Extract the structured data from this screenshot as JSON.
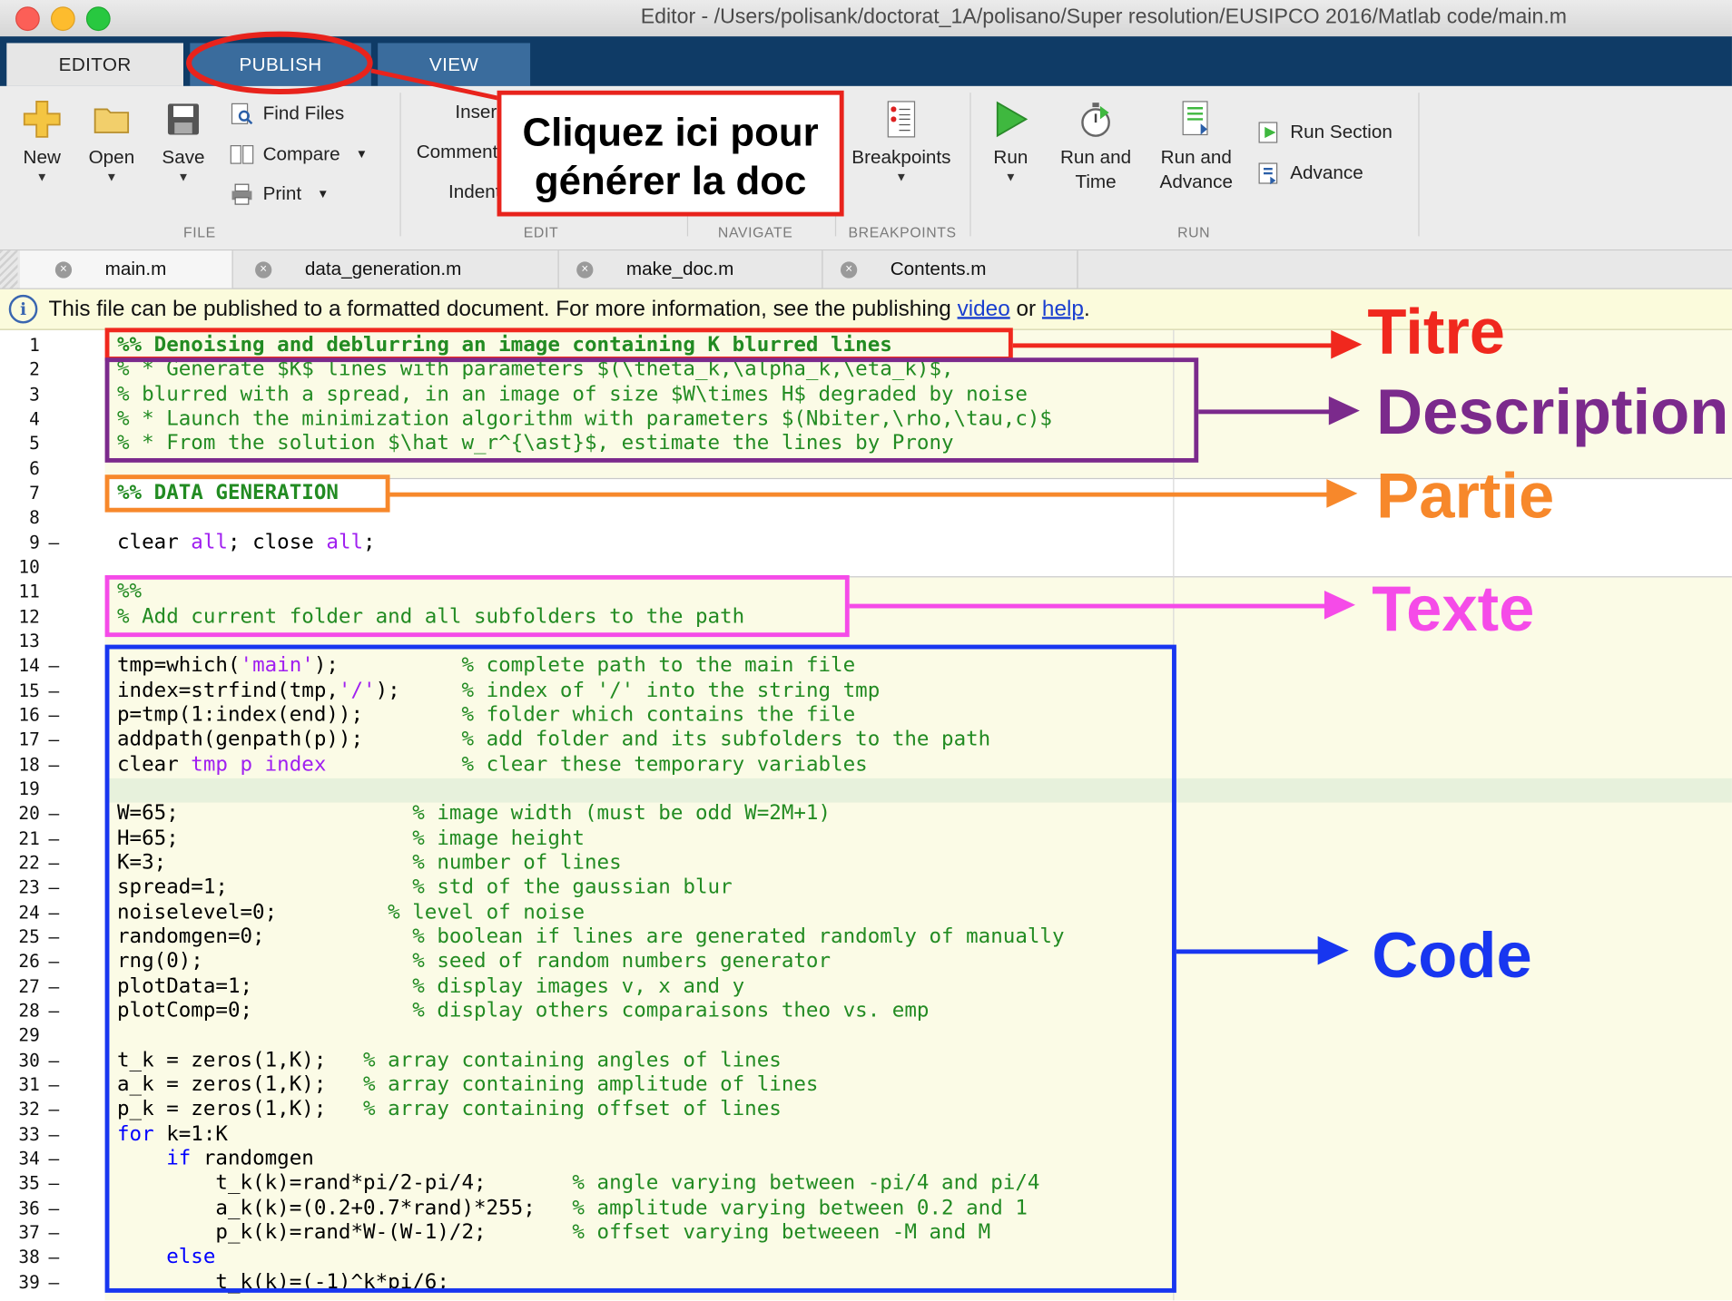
{
  "window": {
    "title": "Editor - /Users/polisank/doctorat_1A/polisano/Super resolution/EUSIPCO 2016/Matlab code/main.m"
  },
  "ribbon_tabs": [
    "EDITOR",
    "PUBLISH",
    "VIEW"
  ],
  "ribbon": {
    "file": {
      "new": "New",
      "open": "Open",
      "save": "Save",
      "find_files": "Find Files",
      "compare": "Compare",
      "print": "Print",
      "label": "FILE"
    },
    "edit": {
      "insert": "Insert",
      "comment": "Comment",
      "indent": "Indent",
      "label": "EDIT"
    },
    "navigate": {
      "label": "NAVIGATE"
    },
    "breakpoints": {
      "breakpoints": "Breakpoints",
      "label": "BREAKPOINTS"
    },
    "run": {
      "run": "Run",
      "run_and_time": [
        "Run and",
        "Time"
      ],
      "run_and_advance": [
        "Run and",
        "Advance"
      ],
      "run_section": "Run Section",
      "advance": "Advance",
      "label": "RUN"
    }
  },
  "file_tabs": [
    "main.m",
    "data_generation.m",
    "make_doc.m",
    "Contents.m"
  ],
  "infobar": {
    "text": "This file can be published to a formatted document. For more information, see the publishing",
    "link_video": "video",
    "or": "or",
    "link_help": "help",
    "end": "."
  },
  "code_lines": [
    [
      [
        "%% Denoising and deblurring an image containing K blurred lines",
        "com bold"
      ]
    ],
    [
      [
        "% * Generate $K$ lines with parameters $(\\theta_k,\\alpha_k,\\eta_k)$,",
        "com"
      ]
    ],
    [
      [
        "% blurred with a spread, in an image of size $W\\times H$ degraded by noise",
        "com"
      ]
    ],
    [
      [
        "% * Launch the minimization algorithm with parameters $(Nbiter,\\rho,\\tau,c)$",
        "com"
      ]
    ],
    [
      [
        "% * From the solution $\\hat w_r^{\\ast}$, estimate the lines by Prony",
        "com"
      ]
    ],
    [],
    [
      [
        "%% DATA GENERATION",
        "com bold"
      ]
    ],
    [],
    [
      [
        "clear ",
        ""
      ],
      [
        "all",
        ""
      ],
      [
        "; close ",
        ""
      ],
      [
        "all",
        ""
      ],
      [
        ";",
        ""
      ]
    ],
    [],
    [
      [
        "%%",
        "com"
      ]
    ],
    [
      [
        "% Add current folder and all subfolders to the path",
        "com"
      ]
    ],
    [],
    [
      [
        "tmp=which(",
        ""
      ],
      [
        "'main'",
        "str"
      ],
      [
        ");          ",
        ""
      ],
      [
        "% complete path to the main file",
        "com"
      ]
    ],
    [
      [
        "index=strfind(tmp,",
        ""
      ],
      [
        "'/'",
        "str"
      ],
      [
        ");     ",
        ""
      ],
      [
        "% index of '/' into the string tmp",
        "com"
      ]
    ],
    [
      [
        "p=tmp(1:index(end));        ",
        ""
      ],
      [
        "% folder which contains the file",
        "com"
      ]
    ],
    [
      [
        "addpath(genpath(p));        ",
        ""
      ],
      [
        "% add folder and its subfolders to the path",
        "com"
      ]
    ],
    [
      [
        "clear ",
        ""
      ],
      [
        "tmp p index",
        "str"
      ],
      [
        "           ",
        ""
      ],
      [
        "% clear these temporary variables",
        "com"
      ]
    ],
    [],
    [
      [
        "W=65;                   ",
        ""
      ],
      [
        "% image width (must be odd W=2M+1)",
        "com"
      ]
    ],
    [
      [
        "H=65;                   ",
        ""
      ],
      [
        "% image height",
        "com"
      ]
    ],
    [
      [
        "K=3;                    ",
        ""
      ],
      [
        "% number of lines",
        "com"
      ]
    ],
    [
      [
        "spread=1;               ",
        ""
      ],
      [
        "% std of the gaussian blur",
        "com"
      ]
    ],
    [
      [
        "noiselevel=0;         ",
        ""
      ],
      [
        "% level of noise",
        "com"
      ]
    ],
    [
      [
        "randomgen=0;            ",
        ""
      ],
      [
        "% boolean if lines are generated randomly of manually",
        "com"
      ]
    ],
    [
      [
        "rng(0);                 ",
        ""
      ],
      [
        "% seed of random numbers generator",
        "com"
      ]
    ],
    [
      [
        "plotData=1;             ",
        ""
      ],
      [
        "% display images v, x and y",
        "com"
      ]
    ],
    [
      [
        "plotComp=0;             ",
        ""
      ],
      [
        "% display others comparaisons theo vs. emp",
        "com"
      ]
    ],
    [],
    [
      [
        "t_k = zeros(1,K);   ",
        ""
      ],
      [
        "% array containing angles of lines",
        "com"
      ]
    ],
    [
      [
        "a_k = zeros(1,K);   ",
        ""
      ],
      [
        "% array containing amplitude of lines",
        "com"
      ]
    ],
    [
      [
        "p_k = zeros(1,K);   ",
        ""
      ],
      [
        "% array containing offset of lines",
        "com"
      ]
    ],
    [
      [
        "for",
        "kw"
      ],
      [
        " k=1:K",
        ""
      ]
    ],
    [
      [
        "    ",
        ""
      ],
      [
        "if",
        "kw"
      ],
      [
        " randomgen",
        ""
      ]
    ],
    [
      [
        "        t_k(k)=rand*pi/2-pi/4;       ",
        ""
      ],
      [
        "% angle varying between -pi/4 and pi/4",
        "com"
      ]
    ],
    [
      [
        "        a_k(k)=(0.2+0.7*rand)*255;   ",
        ""
      ],
      [
        "% amplitude varying between 0.2 and 1",
        "com"
      ]
    ],
    [
      [
        "        p_k(k)=rand*W-(W-1)/2;       ",
        ""
      ],
      [
        "% offset varying betweeen -M and M",
        "com"
      ]
    ],
    [
      [
        "    ",
        ""
      ],
      [
        "else",
        "kw"
      ]
    ],
    [
      [
        "        t_k(k)=(-1)^k*pi/6;",
        ""
      ]
    ]
  ],
  "line_numbers": [
    "1",
    "2",
    "3",
    "4",
    "5",
    "6",
    "7",
    "8",
    "9",
    "10",
    "11",
    "12",
    "13",
    "14",
    "15",
    "16",
    "17",
    "18",
    "19",
    "20",
    "21",
    "22",
    "23",
    "24",
    "25",
    "26",
    "27",
    "28",
    "29",
    "30",
    "31",
    "32",
    "33",
    "34",
    "35",
    "36",
    "37",
    "38",
    "39"
  ],
  "executable_lines": [
    "9",
    "14",
    "15",
    "16",
    "17",
    "18",
    "20",
    "21",
    "22",
    "23",
    "24",
    "25",
    "26",
    "27",
    "28",
    "30",
    "31",
    "32",
    "33",
    "34",
    "35",
    "36",
    "37",
    "38",
    "39"
  ],
  "annotations": {
    "callout": [
      "Cliquez ici pour",
      "générer la doc"
    ],
    "titre": "Titre",
    "description": "Description",
    "partie": "Partie",
    "texte": "Texte",
    "code": "Code"
  },
  "colors": {
    "titre": "#f0281e",
    "description": "#7b2a8c",
    "partie": "#f7882b",
    "texte": "#f54be8",
    "code": "#1836f0",
    "ribbon_dark": "#0f3b66",
    "comment": "#228b22",
    "keyword": "#0000ff",
    "string": "#a020f0"
  }
}
